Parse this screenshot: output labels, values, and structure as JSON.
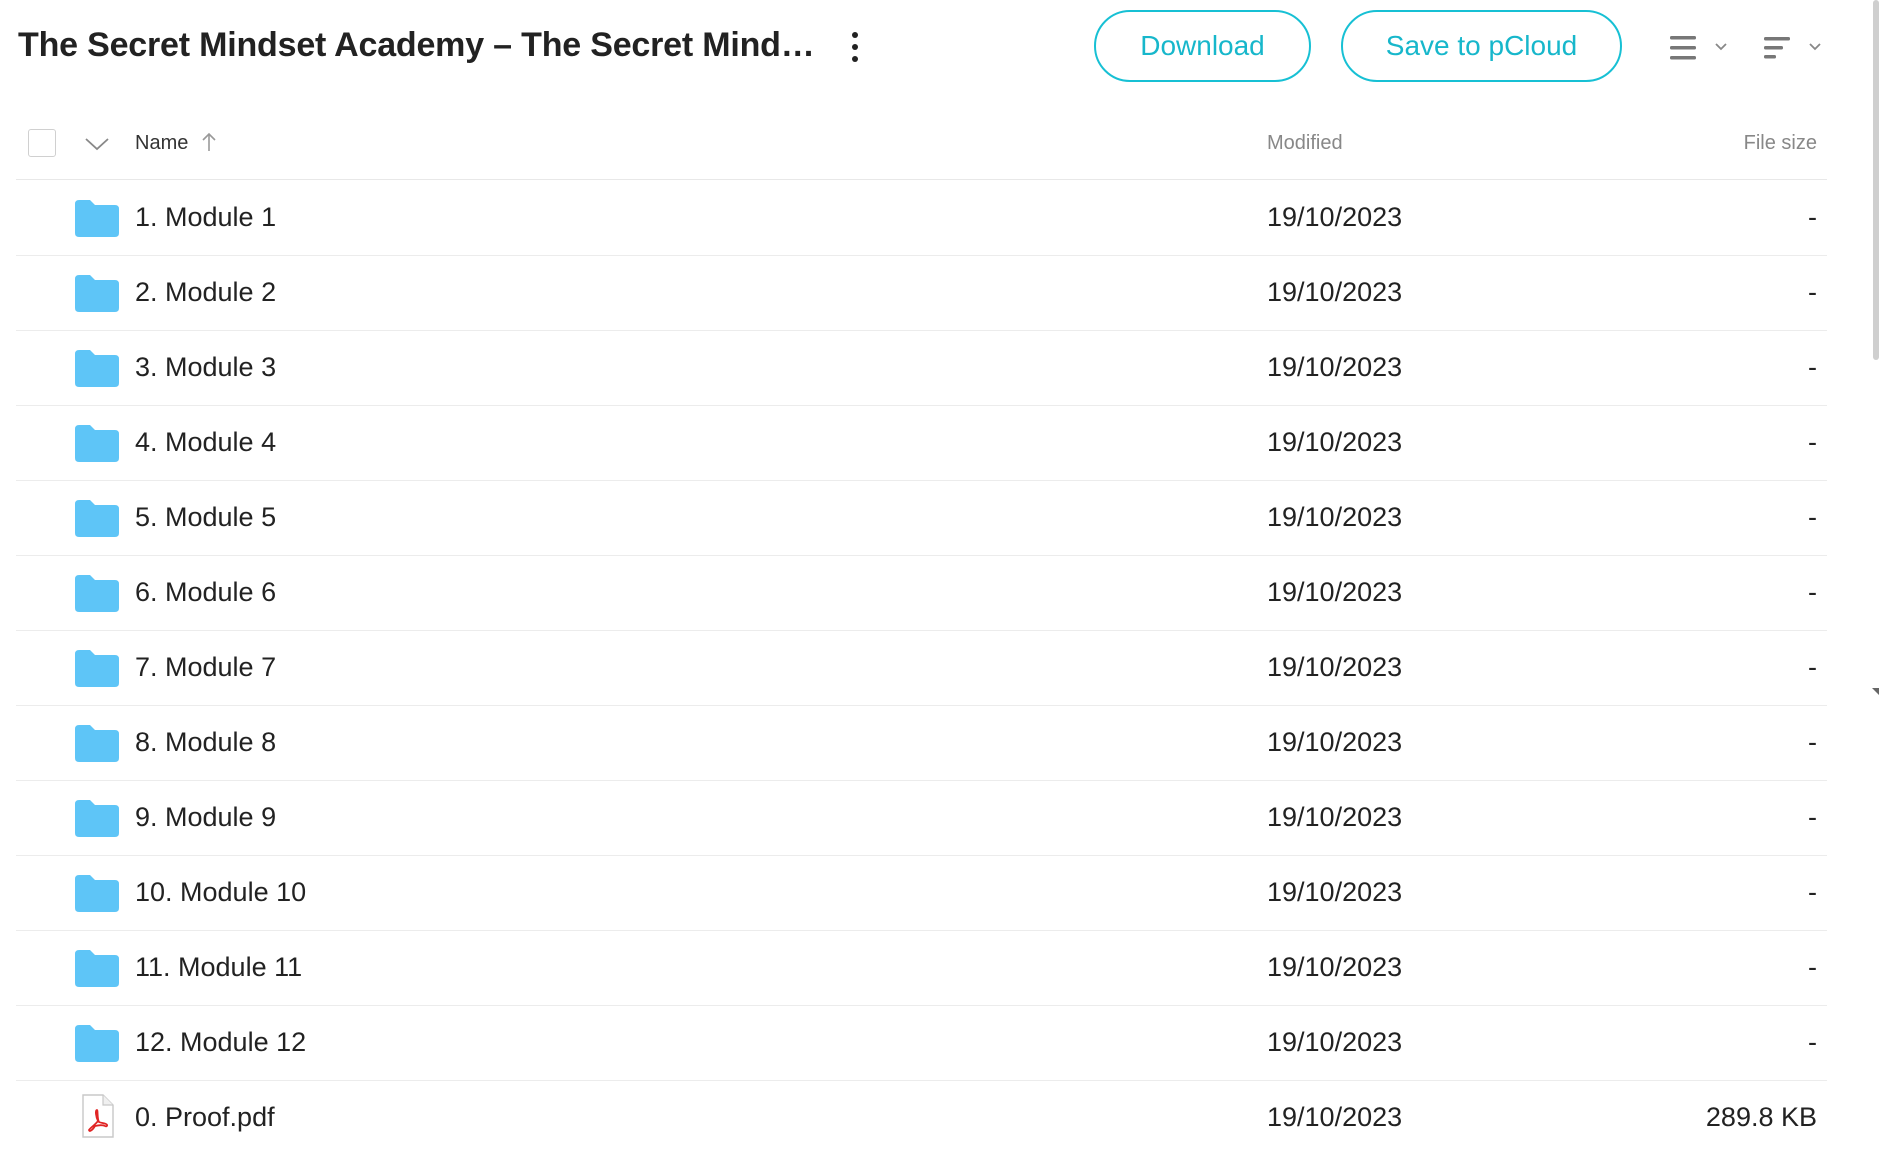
{
  "header": {
    "title": "The Secret Mindset Academy – The Secret Mindset Academy",
    "more_icon": "more-vertical-icon",
    "download_label": "Download",
    "save_label": "Save to pCloud",
    "view_icon": "list-view-icon",
    "sort_icon": "sort-icon"
  },
  "columns": {
    "name": "Name",
    "modified": "Modified",
    "size": "File size"
  },
  "colors": {
    "accent": "#17b7cb",
    "folder": "#5ec5f7",
    "pdf_red": "#e02424"
  },
  "items": [
    {
      "type": "folder",
      "name": "1. Module 1",
      "modified": "19/10/2023",
      "size": "-"
    },
    {
      "type": "folder",
      "name": "2. Module 2",
      "modified": "19/10/2023",
      "size": "-"
    },
    {
      "type": "folder",
      "name": "3. Module 3",
      "modified": "19/10/2023",
      "size": "-"
    },
    {
      "type": "folder",
      "name": "4. Module 4",
      "modified": "19/10/2023",
      "size": "-"
    },
    {
      "type": "folder",
      "name": "5. Module 5",
      "modified": "19/10/2023",
      "size": "-"
    },
    {
      "type": "folder",
      "name": "6. Module 6",
      "modified": "19/10/2023",
      "size": "-"
    },
    {
      "type": "folder",
      "name": "7. Module 7",
      "modified": "19/10/2023",
      "size": "-"
    },
    {
      "type": "folder",
      "name": "8. Module 8",
      "modified": "19/10/2023",
      "size": "-"
    },
    {
      "type": "folder",
      "name": "9. Module 9",
      "modified": "19/10/2023",
      "size": "-"
    },
    {
      "type": "folder",
      "name": "10. Module 10",
      "modified": "19/10/2023",
      "size": "-"
    },
    {
      "type": "folder",
      "name": "11. Module 11",
      "modified": "19/10/2023",
      "size": "-"
    },
    {
      "type": "folder",
      "name": "12. Module 12",
      "modified": "19/10/2023",
      "size": "-"
    },
    {
      "type": "pdf",
      "name": "0. Proof.pdf",
      "modified": "19/10/2023",
      "size": "289.8 KB"
    }
  ]
}
